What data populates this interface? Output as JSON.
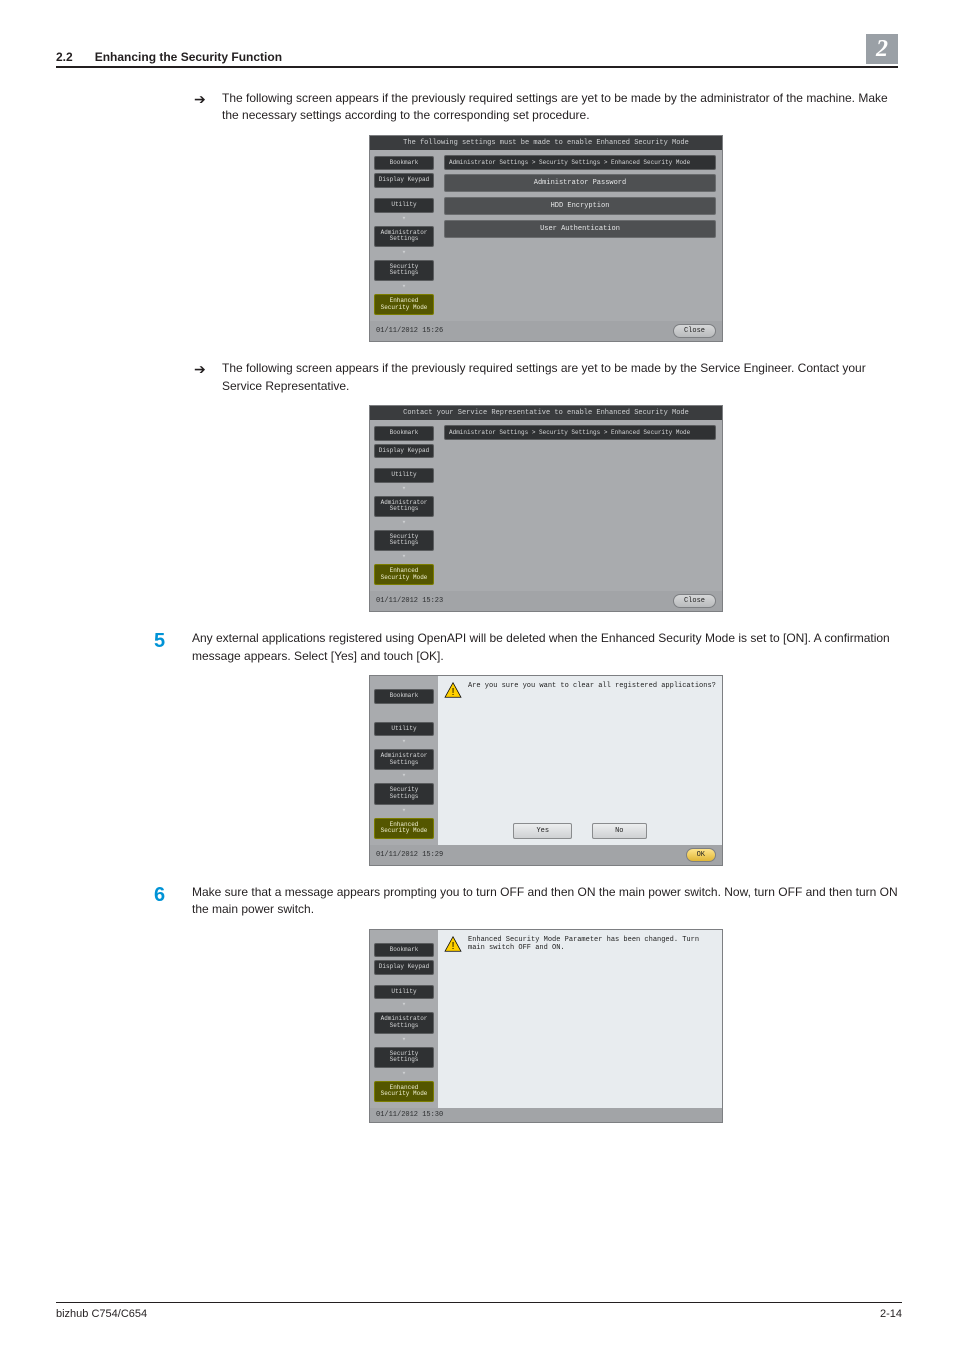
{
  "header": {
    "section_no": "2.2",
    "section_title": "Enhancing the Security Function",
    "chapter_no": "2"
  },
  "block1": {
    "text": "The following screen appears if the previously required settings are yet to be made by the administrator of the machine. Make the necessary settings according to the corresponding set procedure."
  },
  "shot1": {
    "top": "The following settings must be made to enable Enhanced Security Mode",
    "side": {
      "bookmark": "Bookmark",
      "keypad": "Display Keypad",
      "utility": "Utility",
      "admin": "Administrator Settings",
      "security": "Security Settings",
      "esm": "Enhanced Security Mode"
    },
    "crumb": "Administrator Settings > Security Settings > Enhanced Security Mode",
    "rows": {
      "r1": "Administrator Password",
      "r2": "HDD Encryption",
      "r3": "User Authentication"
    },
    "time": "01/11/2012   15:26",
    "close": "Close"
  },
  "block2": {
    "text": "The following screen appears if the previously required settings are yet to be made by the Service Engineer. Contact your Service Representative."
  },
  "shot2": {
    "top": "Contact your Service Representative to enable Enhanced Security Mode",
    "time": "01/11/2012   15:23",
    "close": "Close"
  },
  "step5": {
    "num": "5",
    "text": "Any external applications registered using OpenAPI will be deleted when the Enhanced Security Mode is set to [ON]. A confirmation message appears. Select [Yes] and touch [OK]."
  },
  "shot3": {
    "alert": "Are you sure you want to clear all registered applications?",
    "yes": "Yes",
    "no": "No",
    "time": "01/11/2012   15:29",
    "ok": "OK"
  },
  "step6": {
    "num": "6",
    "text": "Make sure that a message appears prompting you to turn OFF and then ON the main power switch. Now, turn OFF and then turn ON the main power switch."
  },
  "shot4": {
    "alert": "Enhanced Security Mode Parameter has been changed. Turn main switch OFF and ON.",
    "time": "01/11/2012   15:30"
  },
  "footer": {
    "product": "bizhub C754/C654",
    "page": "2-14"
  }
}
